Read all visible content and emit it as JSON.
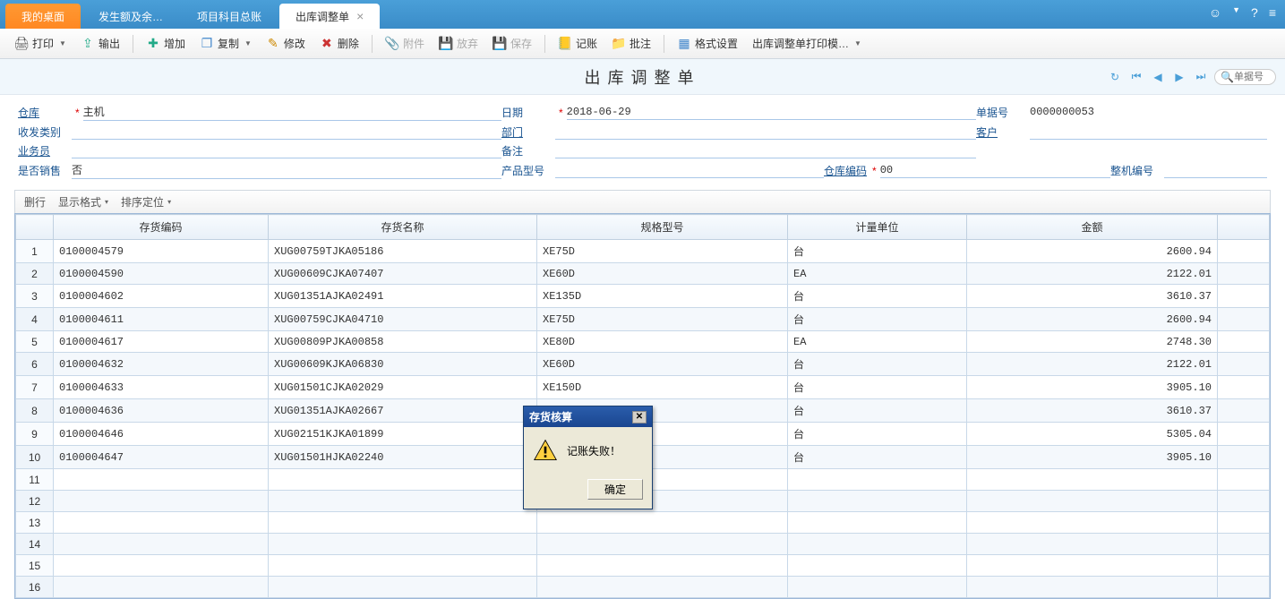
{
  "tabs": {
    "t0": "我的桌面",
    "t1": "发生额及余…",
    "t2": "项目科目总账",
    "t3": "出库调整单"
  },
  "toolbar": {
    "print": "打印",
    "export": "输出",
    "add": "增加",
    "copy": "复制",
    "edit": "修改",
    "delete": "删除",
    "attach": "附件",
    "discard": "放弃",
    "save": "保存",
    "post": "记账",
    "batch": "批注",
    "format": "格式设置",
    "template": "出库调整单打印模…"
  },
  "title": "出库调整单",
  "nav": {
    "search_ph": "单据号"
  },
  "form": {
    "warehouse_label": "仓库",
    "warehouse_value": "主机",
    "date_label": "日期",
    "date_value": "2018-06-29",
    "docno_label": "单据号",
    "docno_value": "0000000053",
    "iotype_label": "收发类别",
    "dept_label": "部门",
    "customer_label": "客户",
    "operator_label": "业务员",
    "remark_label": "备注",
    "issale_label": "是否销售",
    "issale_value": "否",
    "model_label": "产品型号",
    "whcode_label": "仓库编码",
    "whcode_value": "00",
    "machine_label": "整机编号"
  },
  "table_toolbar": {
    "delrow": "删行",
    "display": "显示格式",
    "sort": "排序定位"
  },
  "columns": {
    "c0": "存货编码",
    "c1": "存货名称",
    "c2": "规格型号",
    "c3": "计量单位",
    "c4": "金额"
  },
  "rows": [
    {
      "n": "1",
      "code": "0100004579",
      "name": "XUG00759TJKA05186",
      "spec": "XE75D",
      "unit": "台",
      "amt": "2600.94"
    },
    {
      "n": "2",
      "code": "0100004590",
      "name": "XUG00609CJKA07407",
      "spec": "XE60D",
      "unit": "EA",
      "amt": "2122.01"
    },
    {
      "n": "3",
      "code": "0100004602",
      "name": "XUG01351AJKA02491",
      "spec": "XE135D",
      "unit": "台",
      "amt": "3610.37"
    },
    {
      "n": "4",
      "code": "0100004611",
      "name": "XUG00759CJKA04710",
      "spec": "XE75D",
      "unit": "台",
      "amt": "2600.94"
    },
    {
      "n": "5",
      "code": "0100004617",
      "name": "XUG00809PJKA00858",
      "spec": "XE80D",
      "unit": "EA",
      "amt": "2748.30"
    },
    {
      "n": "6",
      "code": "0100004632",
      "name": "XUG00609KJKA06830",
      "spec": "XE60D",
      "unit": "台",
      "amt": "2122.01"
    },
    {
      "n": "7",
      "code": "0100004633",
      "name": "XUG01501CJKA02029",
      "spec": "XE150D",
      "unit": "台",
      "amt": "3905.10"
    },
    {
      "n": "8",
      "code": "0100004636",
      "name": "XUG01351AJKA02667",
      "spec": "XE135D",
      "unit": "台",
      "amt": "3610.37"
    },
    {
      "n": "9",
      "code": "0100004646",
      "name": "XUG02151KJKA01899",
      "spec": "",
      "unit": "台",
      "amt": "5305.04"
    },
    {
      "n": "10",
      "code": "0100004647",
      "name": "XUG01501HJKA02240",
      "spec": "",
      "unit": "台",
      "amt": "3905.10"
    },
    {
      "n": "11",
      "code": "",
      "name": "",
      "spec": "",
      "unit": "",
      "amt": ""
    },
    {
      "n": "12",
      "code": "",
      "name": "",
      "spec": "",
      "unit": "",
      "amt": ""
    },
    {
      "n": "13",
      "code": "",
      "name": "",
      "spec": "",
      "unit": "",
      "amt": ""
    },
    {
      "n": "14",
      "code": "",
      "name": "",
      "spec": "",
      "unit": "",
      "amt": ""
    },
    {
      "n": "15",
      "code": "",
      "name": "",
      "spec": "",
      "unit": "",
      "amt": ""
    },
    {
      "n": "16",
      "code": "",
      "name": "",
      "spec": "",
      "unit": "",
      "amt": ""
    }
  ],
  "dialog": {
    "title": "存货核算",
    "message": "记账失败！",
    "ok": "确定"
  }
}
